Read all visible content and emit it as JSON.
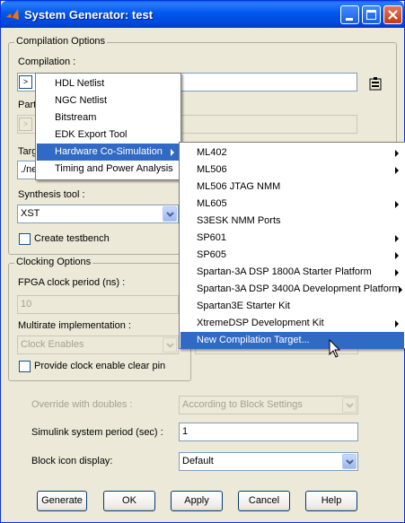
{
  "window": {
    "title": "System Generator: test"
  },
  "compilation_options": {
    "legend": "Compilation Options",
    "compilation_label": "Compilation :",
    "part_label": "Part",
    "target_label": "Targ",
    "target_value": "./ne",
    "synthesis_label": "Synthesis tool :",
    "synthesis_value": "XST",
    "testbench_label": "Create testbench"
  },
  "clocking_options": {
    "legend": "Clocking Options",
    "fpga_clock_label": "FPGA clock period (ns) :",
    "fpga_clock_value": "10",
    "multirate_label": "Multirate implementation :",
    "multirate_value": "Clock Enables",
    "clear_pin_label": "Provide clock enable clear pin"
  },
  "lower": {
    "override_label": "Override with doubles :",
    "override_value": "According to Block Settings",
    "sim_period_label": "Simulink system period (sec) :",
    "sim_period_value": "1",
    "block_icon_label": "Block icon display:",
    "block_icon_value": "Default"
  },
  "buttons": {
    "generate": "Generate",
    "ok": "OK",
    "apply": "Apply",
    "cancel": "Cancel",
    "help": "Help"
  },
  "menu1": {
    "items": [
      {
        "label": "HDL Netlist"
      },
      {
        "label": "NGC Netlist"
      },
      {
        "label": "Bitstream"
      },
      {
        "label": "EDK Export Tool"
      },
      {
        "label": "Hardware Co-Simulation"
      },
      {
        "label": "Timing and Power Analysis"
      }
    ]
  },
  "menu2": {
    "items": [
      {
        "label": "ML402"
      },
      {
        "label": "ML506"
      },
      {
        "label": "ML506 JTAG NMM"
      },
      {
        "label": "ML605"
      },
      {
        "label": "S3ESK NMM Ports"
      },
      {
        "label": "SP601"
      },
      {
        "label": "SP605"
      },
      {
        "label": "Spartan-3A DSP 1800A Starter Platform"
      },
      {
        "label": "Spartan-3A DSP 3400A Development Platform"
      },
      {
        "label": "Spartan3E Starter Kit"
      },
      {
        "label": "XtremeDSP Development Kit"
      },
      {
        "label": "New Compilation Target..."
      }
    ]
  },
  "mini_button_glyph": ">",
  "colors": {
    "selection": "#316AC5",
    "titlebar": "#0058EE",
    "dialog_bg": "#ECE9D8"
  }
}
